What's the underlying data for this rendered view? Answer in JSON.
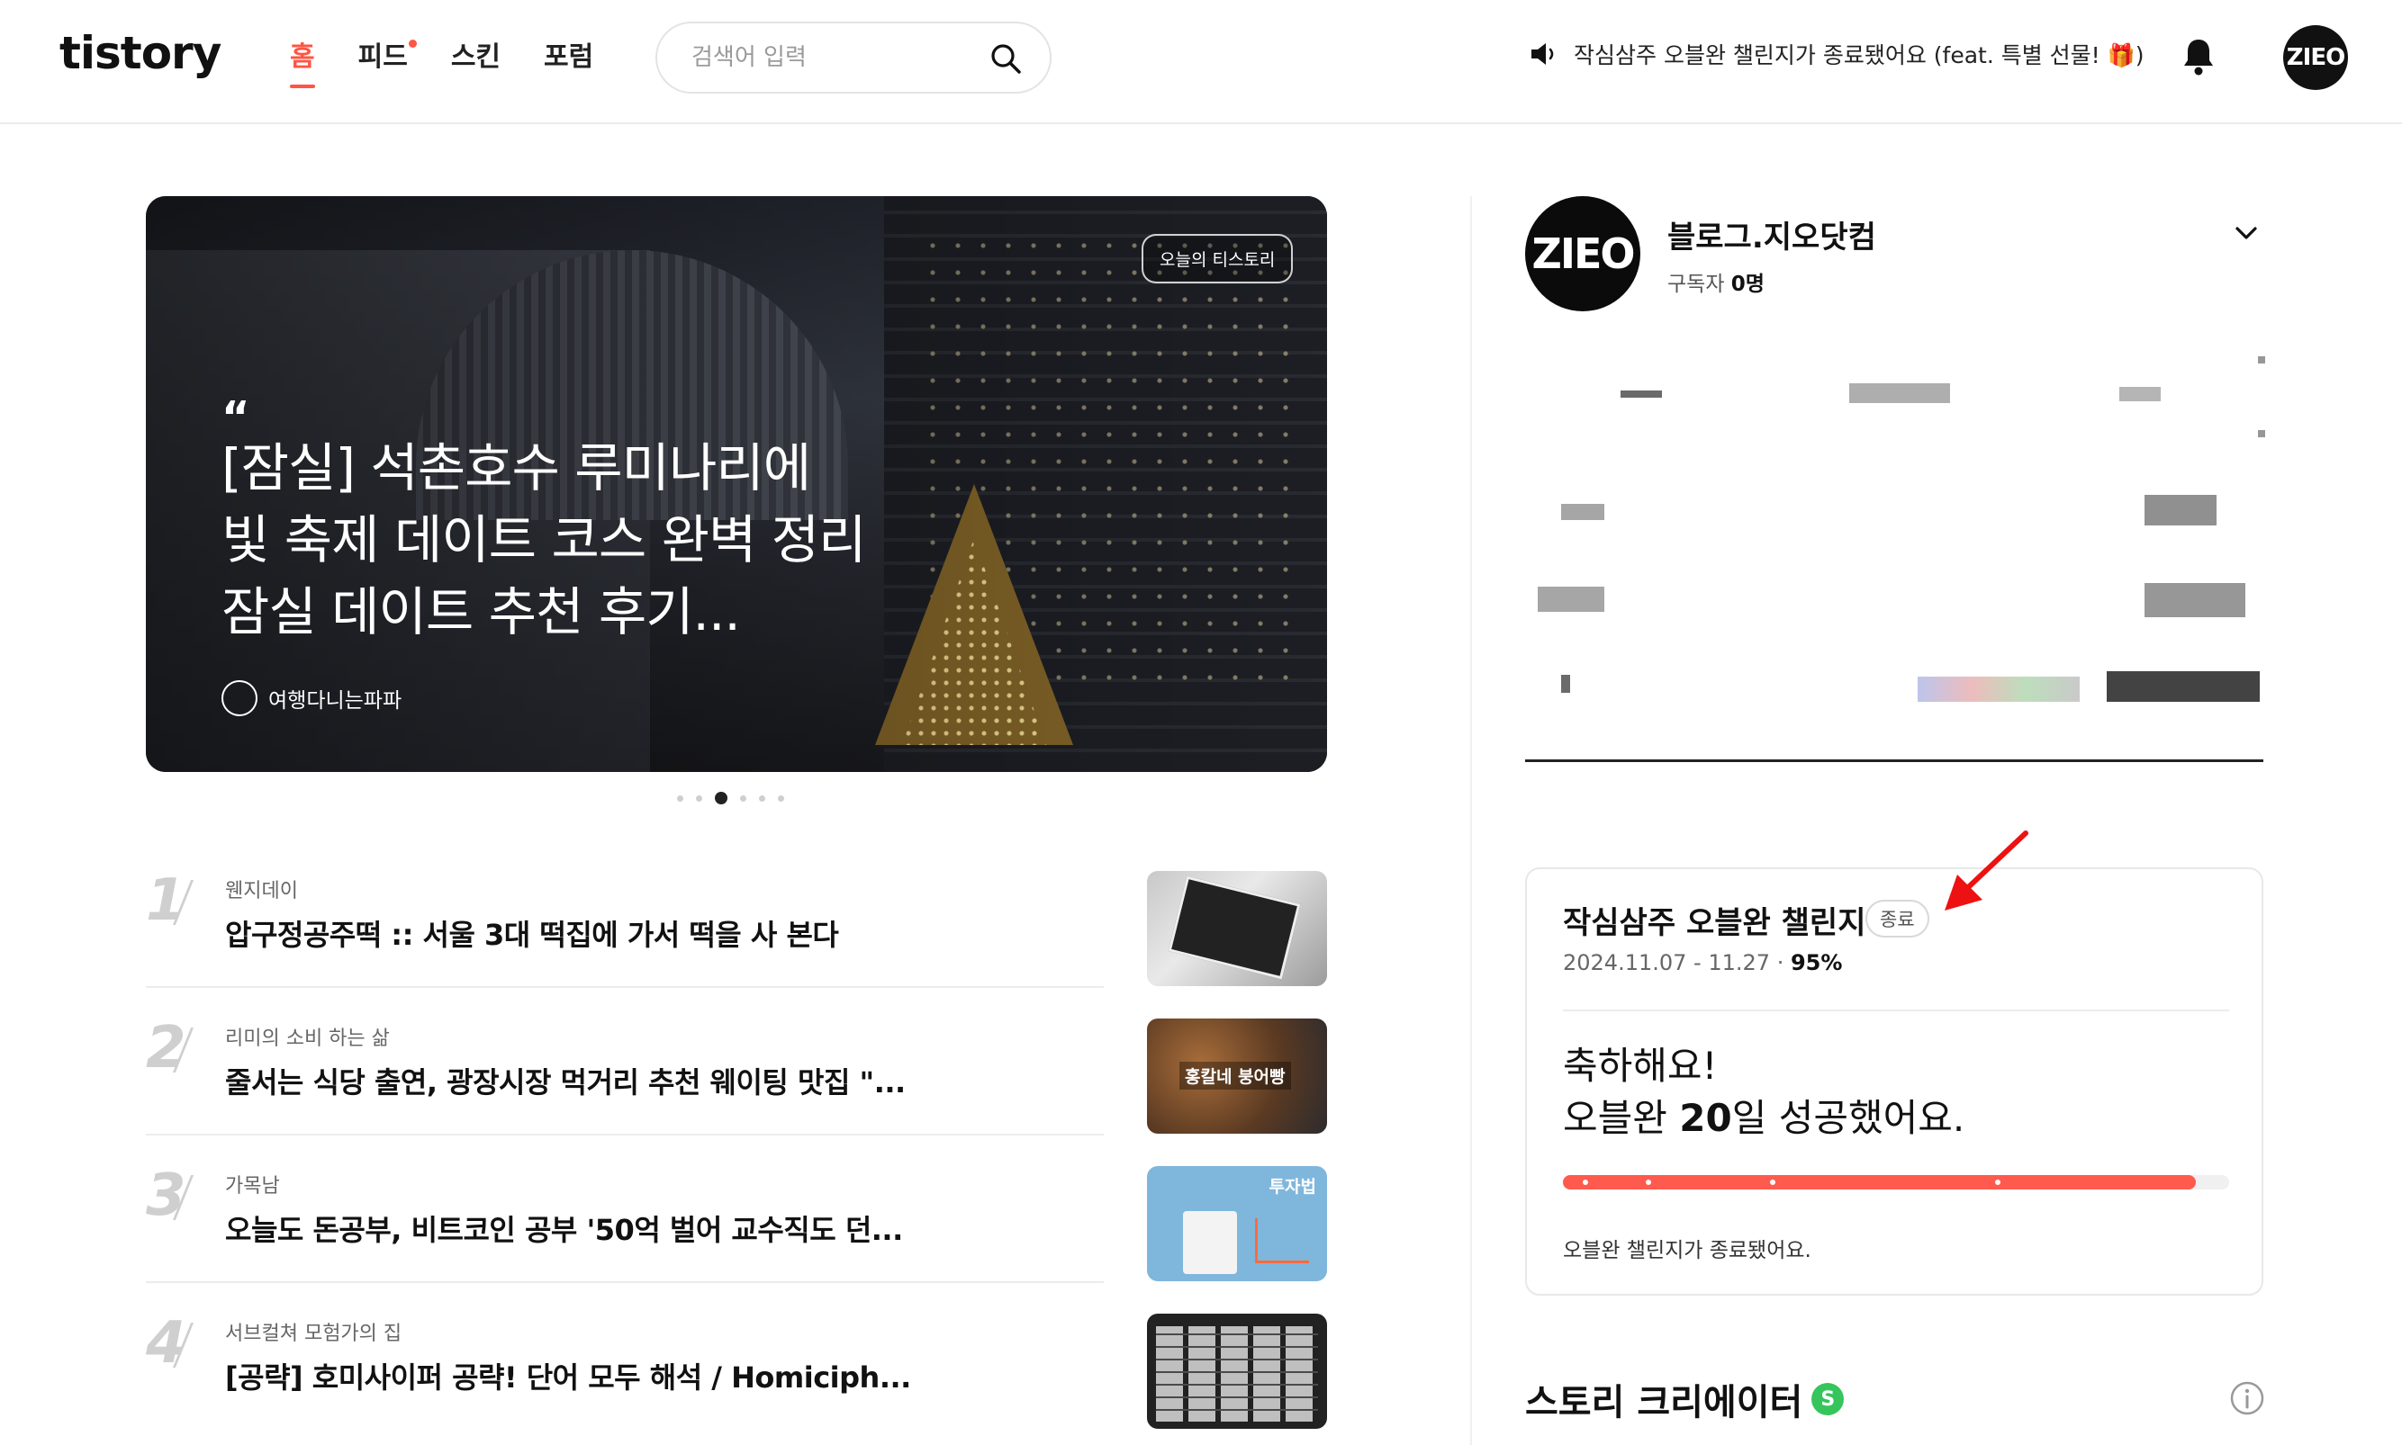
{
  "header": {
    "logo": "tistory",
    "nav": [
      {
        "label": "홈",
        "active": true
      },
      {
        "label": "피드",
        "has_new": true
      },
      {
        "label": "스킨"
      },
      {
        "label": "포럼"
      }
    ],
    "search_placeholder": "검색어 입력",
    "notice": "작심삼주 오블완 챌린지가 종료됐어요 (feat. 특별 선물! 🎁)",
    "avatar_text": "ZIEO"
  },
  "hero": {
    "badge": "오늘의 티스토리",
    "quote_mark": "“",
    "title": "[잠실] 석촌호수 루미나리에 빛 축제 데이트 코스 완벽 정리 잠실 데이트 추천 후기...",
    "author": "여행다니는파파",
    "slides_total": 6,
    "active_slide": 2
  },
  "rank_list": [
    {
      "rank": "1",
      "blog": "웬지데이",
      "title": "압구정공주떡 :: 서울 3대 떡집에 가서 떡을 사 본다"
    },
    {
      "rank": "2",
      "blog": "리미의 소비 하는 삶",
      "title": "줄서는 식당 출연, 광장시장 먹거리 추천 웨이팅 맛집 \"...",
      "thumb_label": "홍칼네 붕어빵"
    },
    {
      "rank": "3",
      "blog": "가목남",
      "title": "오늘도 돈공부, 비트코인 공부 '50억 벌어 교수직도 던...",
      "thumb_label": "투자법"
    },
    {
      "rank": "4",
      "blog": "서브컬쳐 모험가의 집",
      "title": "[공략] 호미사이퍼 공략! 단어 모두 해석 / Homiciph..."
    }
  ],
  "profile": {
    "avatar_text": "ZIEO",
    "name": "블로그.지오닷컴",
    "subs_label": "구독자",
    "subs_count": "0명"
  },
  "challenge": {
    "title": "작심삼주 오블완 챌린지",
    "badge": "종료",
    "period": "2024.11.07 - 11.27",
    "separator": "·",
    "percent": "95%",
    "progress": 0.95,
    "congrats_line1": "축하해요!",
    "congrats_prefix": "오블완 ",
    "congrats_days": "20",
    "congrats_suffix": "일 성공했어요.",
    "footer": "오블완 챌린지가 종료됐어요."
  },
  "story_creator": {
    "title": "스토리 크리에이터",
    "badge": "S"
  },
  "colors": {
    "accent": "#ff5544",
    "progress": "#ff5a4e",
    "creator_badge": "#35c55c"
  }
}
